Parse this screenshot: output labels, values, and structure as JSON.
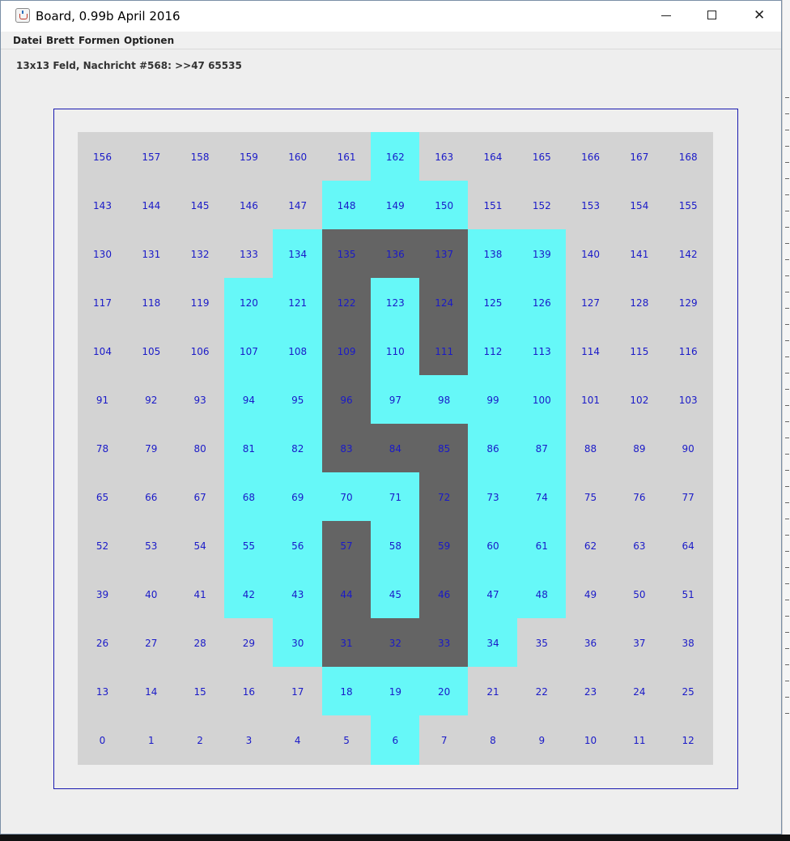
{
  "window": {
    "title": "Board, 0.99b April 2016",
    "controls": {
      "minimize_icon": "minimize-icon",
      "maximize_icon": "maximize-icon",
      "close_icon": "close-icon"
    }
  },
  "menu": [
    "Datei",
    "Brett",
    "Formen",
    "Optionen"
  ],
  "status": "13x13 Feld, Nachricht #568: >>47 65535",
  "colors": {
    "empty": "#d3d3d3",
    "cyan": "#66f8f8",
    "dark": "#646464",
    "label": "#1a1ac8",
    "frame": "#1a1ab0"
  },
  "board": {
    "size": 13,
    "rows": [
      "......C......",
      ".....CCC.....",
      "....CDDDCC...",
      "...CCDCDCC...",
      "...CCDCDCC...",
      "...CCDCCCC...",
      "...CCDDDCC...",
      "...CCCCDCC...",
      "...CCDCDCC...",
      "...CCDCDCC...",
      "....CDDDC....",
      ".....CCC.....",
      "......C......"
    ]
  }
}
